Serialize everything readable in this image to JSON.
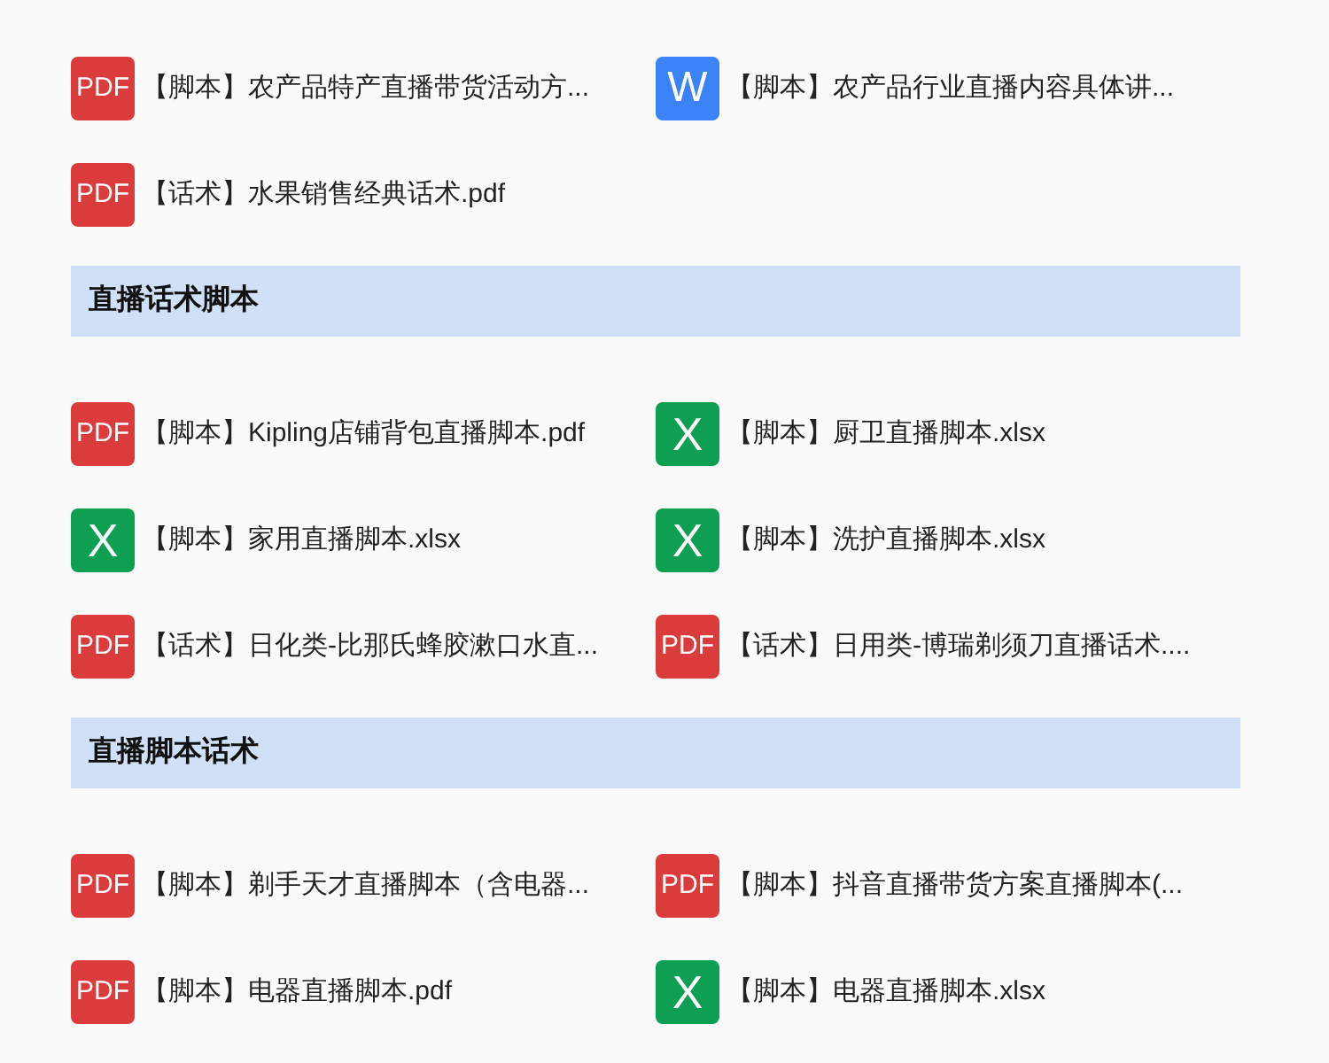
{
  "groups": [
    {
      "files": [
        {
          "kind": "pdf",
          "badge": "PDF",
          "name": "【脚本】农产品特产直播带货活动方..."
        },
        {
          "kind": "word",
          "badge": "W",
          "name": "【脚本】农产品行业直播内容具体讲..."
        },
        {
          "kind": "pdf",
          "badge": "PDF",
          "name": "【话术】水果销售经典话术.pdf"
        }
      ]
    },
    {
      "heading": "直播话术脚本",
      "files": [
        {
          "kind": "pdf",
          "badge": "PDF",
          "name": "【脚本】Kipling店铺背包直播脚本.pdf"
        },
        {
          "kind": "excel",
          "badge": "X",
          "name": "【脚本】厨卫直播脚本.xlsx"
        },
        {
          "kind": "excel",
          "badge": "X",
          "name": "【脚本】家用直播脚本.xlsx"
        },
        {
          "kind": "excel",
          "badge": "X",
          "name": "【脚本】洗护直播脚本.xlsx"
        },
        {
          "kind": "pdf",
          "badge": "PDF",
          "name": "【话术】日化类-比那氏蜂胶漱口水直..."
        },
        {
          "kind": "pdf",
          "badge": "PDF",
          "name": "【话术】日用类-博瑞剃须刀直播话术...."
        }
      ]
    },
    {
      "heading": "直播脚本话术",
      "files": [
        {
          "kind": "pdf",
          "badge": "PDF",
          "name": "【脚本】剃手天才直播脚本（含电器..."
        },
        {
          "kind": "pdf",
          "badge": "PDF",
          "name": "【脚本】抖音直播带货方案直播脚本(..."
        },
        {
          "kind": "pdf",
          "badge": "PDF",
          "name": "【脚本】电器直播脚本.pdf"
        },
        {
          "kind": "excel",
          "badge": "X",
          "name": "【脚本】电器直播脚本.xlsx"
        }
      ]
    }
  ]
}
